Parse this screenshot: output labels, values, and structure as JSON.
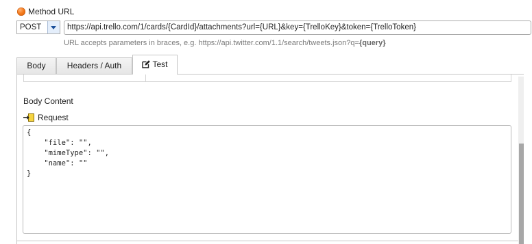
{
  "method_url": {
    "heading": "Method URL",
    "method_value": "POST",
    "url_value": "https://api.trello.com/1/cards/{CardId}/attachments?url={URL}&key={TrelloKey}&token={TrelloToken}",
    "hint_prefix": "URL accepts parameters in braces, e.g. https://api.twitter.com/1.1/search/tweets.json?q=",
    "hint_param": "{query}"
  },
  "tabs": [
    {
      "label": "Body"
    },
    {
      "label": "Headers / Auth"
    },
    {
      "label": "Test",
      "icon": "edit-icon",
      "active": true
    }
  ],
  "test_panel": {
    "body_content_label": "Body Content",
    "request_label": "Request",
    "request_icon": "arrow-into-box-icon",
    "code_lines": [
      "{",
      "    \"file\": \"\",",
      "    \"mimeType\": \"\",",
      "    \"name\": \"\"",
      "}"
    ]
  },
  "colors": {
    "status_dot": "#f57c1f",
    "dropdown_arrow": "#1a4f9a",
    "request_icon_fill": "#f5d442",
    "scroll_thumb": "#a7a7a7"
  }
}
